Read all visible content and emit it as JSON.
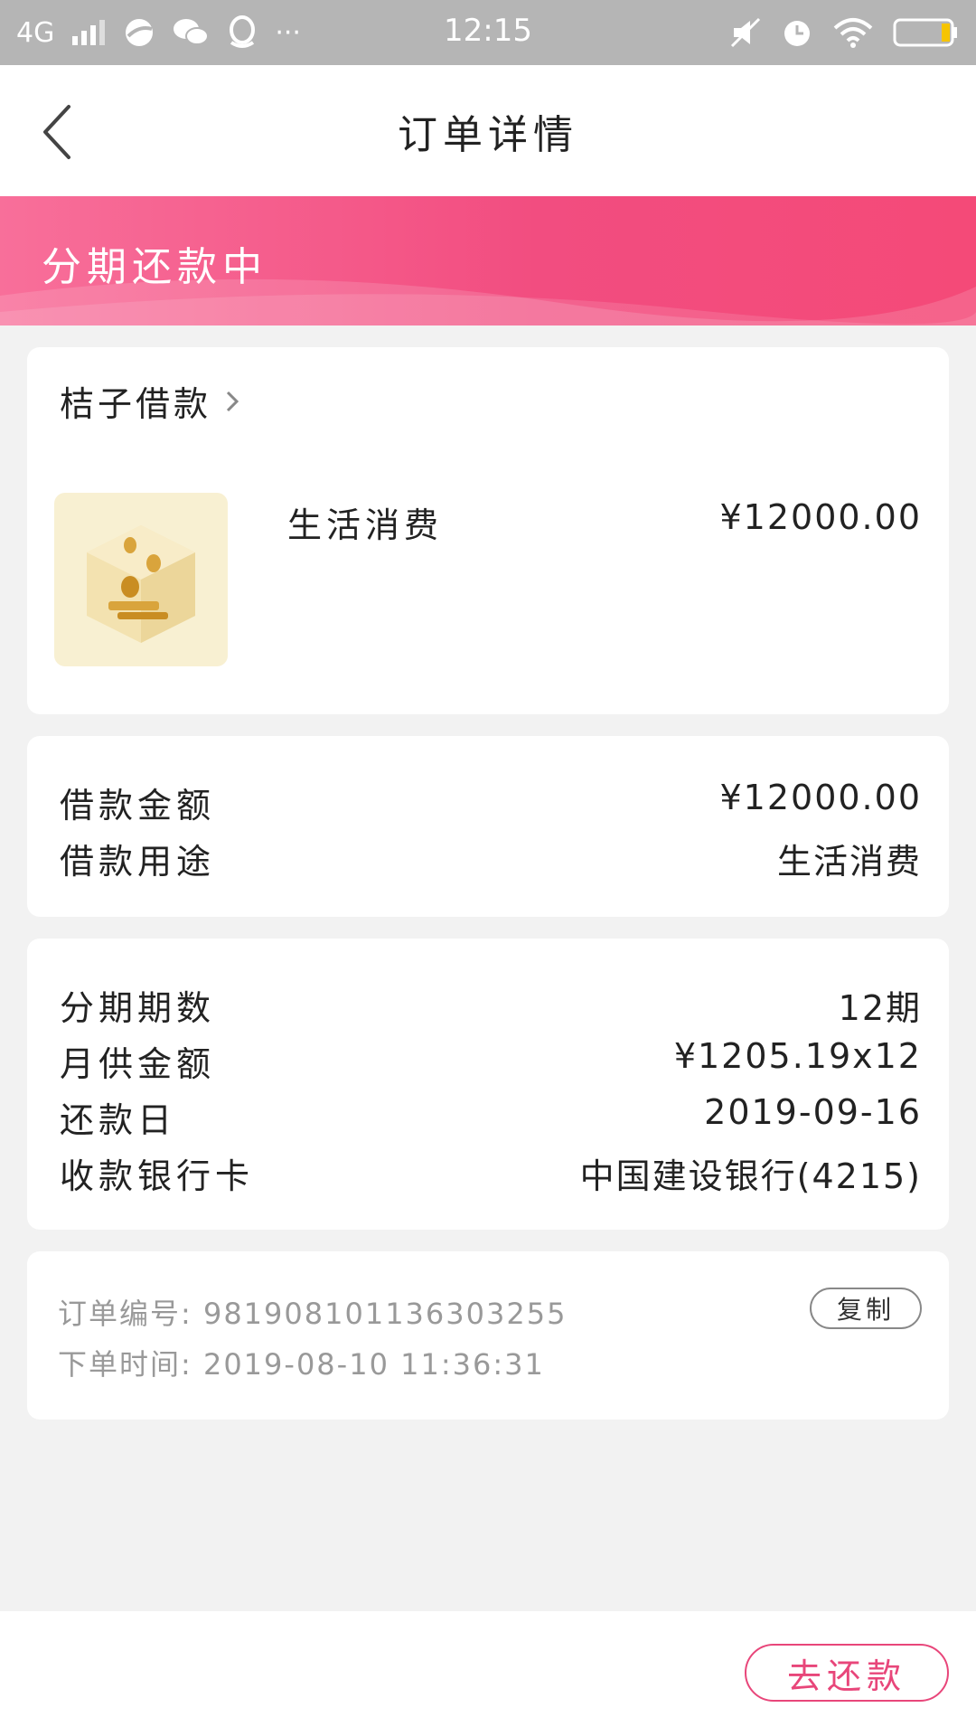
{
  "status_bar": {
    "network": "4G",
    "time": "12:15",
    "icons": [
      "signal-icon",
      "browser-icon",
      "wechat-icon",
      "qq-icon",
      "more-icon",
      "mute-icon",
      "alarm-icon",
      "wifi-icon",
      "battery-icon"
    ],
    "more": "···"
  },
  "nav": {
    "title": "订单详情",
    "back_icon": "chevron-left-icon"
  },
  "banner": {
    "status": "分期还款中"
  },
  "product_card": {
    "merchant": "桔子借款",
    "product_name": "生活消费",
    "price": "¥12000.00"
  },
  "loan_card": {
    "rows": [
      {
        "label": "借款金额",
        "value": "¥12000.00"
      },
      {
        "label": "借款用途",
        "value": "生活消费"
      }
    ]
  },
  "installment_card": {
    "rows": [
      {
        "label": "分期期数",
        "value": "12期"
      },
      {
        "label": "月供金额",
        "value": "¥1205.19x12"
      },
      {
        "label": "还款日",
        "value": "2019-09-16"
      },
      {
        "label": "收款银行卡",
        "value": "中国建设银行(4215)"
      }
    ]
  },
  "order_card": {
    "order_no": "订单编号: 981908101136303255",
    "order_time": "下单时间: 2019-08-10 11:36:31",
    "copy_label": "复制"
  },
  "bottom": {
    "repay_label": "去还款"
  },
  "colors": {
    "accent": "#f24d80",
    "status_bar": "#b5b5b5",
    "background": "#f2f2f2"
  }
}
